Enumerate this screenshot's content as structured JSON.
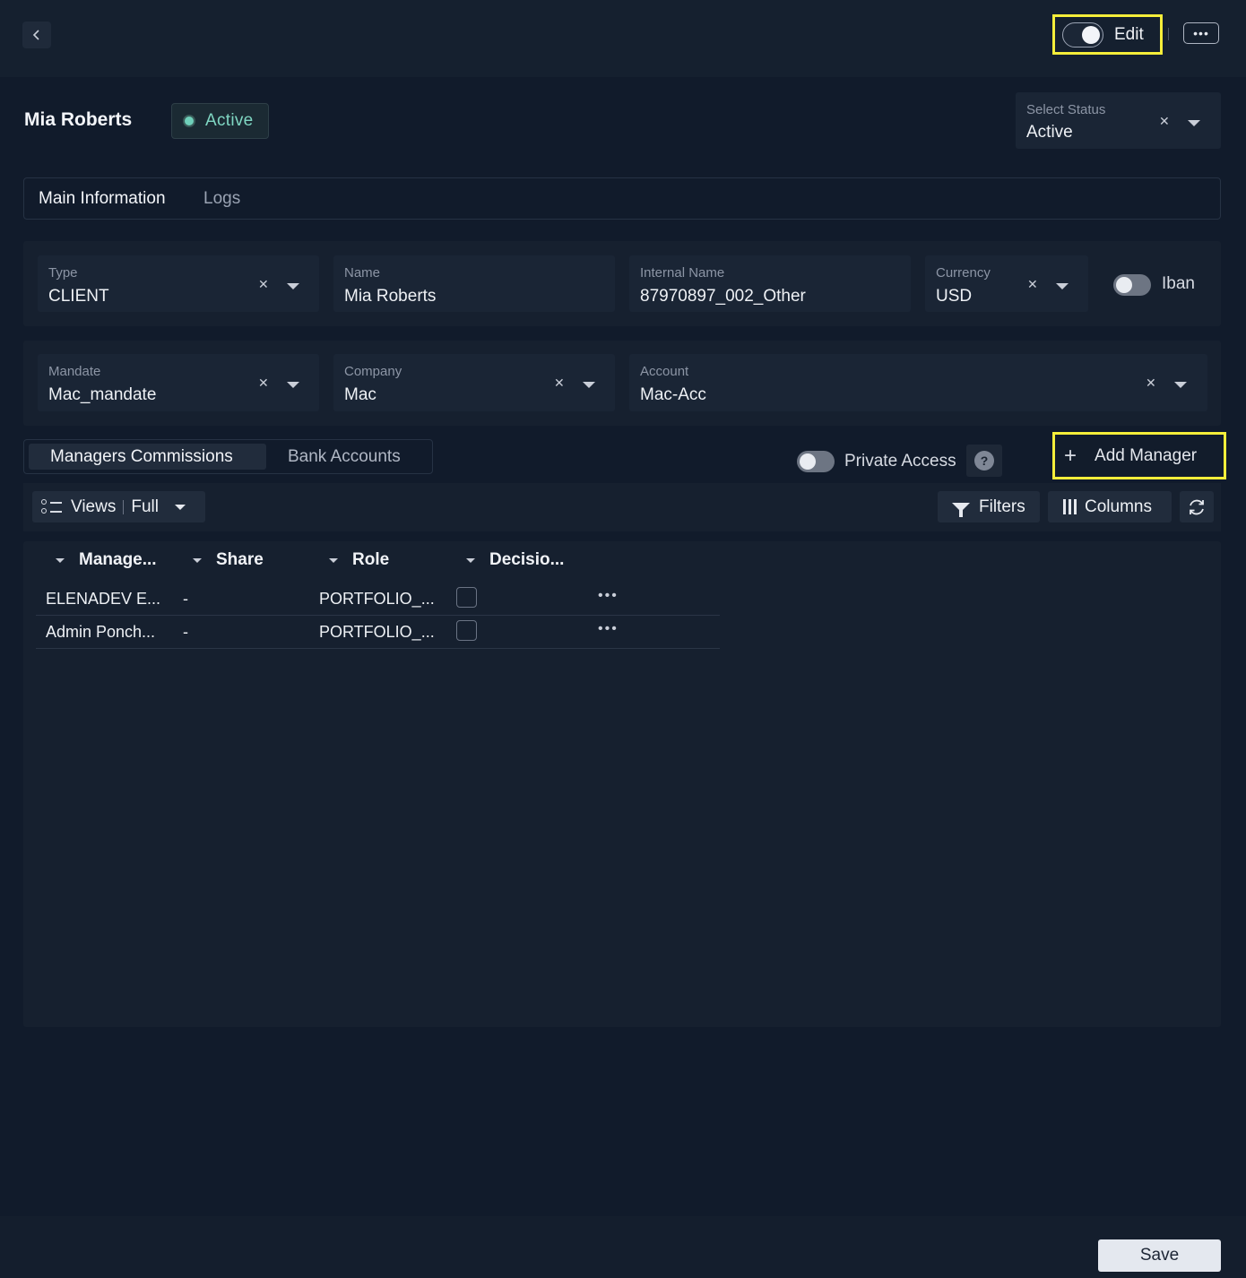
{
  "header": {
    "back_icon": "chevron-left-icon",
    "edit_label": "Edit",
    "edit_on": true,
    "more_icon": "ellipsis-icon"
  },
  "profile": {
    "name": "Mia Roberts",
    "status_badge": "Active",
    "status_color": "#6fd0ba",
    "select_status": {
      "label": "Select Status",
      "value": "Active"
    }
  },
  "tabs": [
    {
      "label": "Main Information",
      "active": true
    },
    {
      "label": "Logs",
      "active": false
    }
  ],
  "fields_row1": {
    "type": {
      "label": "Type",
      "value": "CLIENT"
    },
    "name": {
      "label": "Name",
      "value": "Mia Roberts"
    },
    "internal_name": {
      "label": "Internal Name",
      "value": "87970897_002_Other"
    },
    "currency": {
      "label": "Currency",
      "value": "USD"
    },
    "iban": {
      "label": "Iban",
      "on": false
    }
  },
  "fields_row2": {
    "mandate": {
      "label": "Mandate",
      "value": "Mac_mandate"
    },
    "company": {
      "label": "Company",
      "value": "Mac"
    },
    "account": {
      "label": "Account",
      "value": "Mac-Acc"
    }
  },
  "subtabs": [
    {
      "label": "Managers Commissions",
      "active": true
    },
    {
      "label": "Bank Accounts",
      "active": false
    }
  ],
  "private_access": {
    "label": "Private Access",
    "on": false,
    "help": "?"
  },
  "add_manager_label": "Add Manager",
  "toolbar": {
    "views_label": "Views",
    "views_value": "Full",
    "filters_label": "Filters",
    "columns_label": "Columns"
  },
  "table": {
    "headers": [
      "Manage...",
      "Share",
      "Role",
      "Decisio..."
    ],
    "rows": [
      {
        "manager": "ELENADEV E...",
        "share": "-",
        "role": "PORTFOLIO_...",
        "decision": false
      },
      {
        "manager": "Admin Ponch...",
        "share": "-",
        "role": "PORTFOLIO_...",
        "decision": false
      }
    ]
  },
  "footer": {
    "save_label": "Save"
  }
}
